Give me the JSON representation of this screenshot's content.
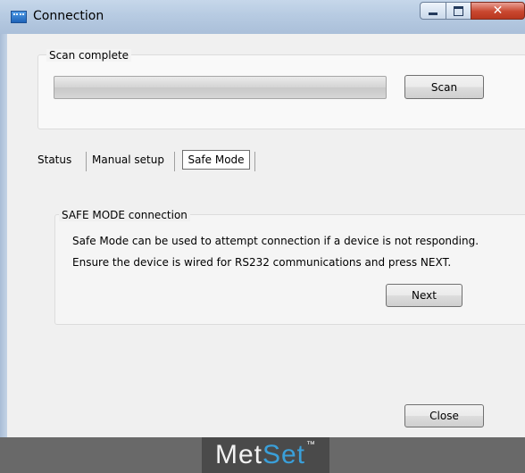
{
  "window": {
    "title": "Connection",
    "app_icon": "app-window-icon",
    "controls": {
      "minimize": "minimize-icon",
      "maximize": "maximize-icon",
      "close": "close-icon",
      "close_glyph": "✕"
    }
  },
  "scan": {
    "legend": "Scan complete",
    "progress": 0,
    "button_label": "Scan"
  },
  "tabs": [
    {
      "label": "Status",
      "selected": false
    },
    {
      "label": "Manual setup",
      "selected": false
    },
    {
      "label": "Safe Mode",
      "selected": true
    }
  ],
  "safe_mode": {
    "legend": "SAFE MODE connection",
    "line1": "Safe Mode can be used to attempt connection if a device is not responding.",
    "line2": "Ensure the device is wired for RS232 communications and press NEXT.",
    "next_label": "Next"
  },
  "close_label": "Close",
  "footer": {
    "logo_part1": "Met",
    "logo_part2": "Set",
    "logo_tm": "™",
    "colors": {
      "background": "#696969",
      "logo_accent": "#3aa0da"
    }
  }
}
